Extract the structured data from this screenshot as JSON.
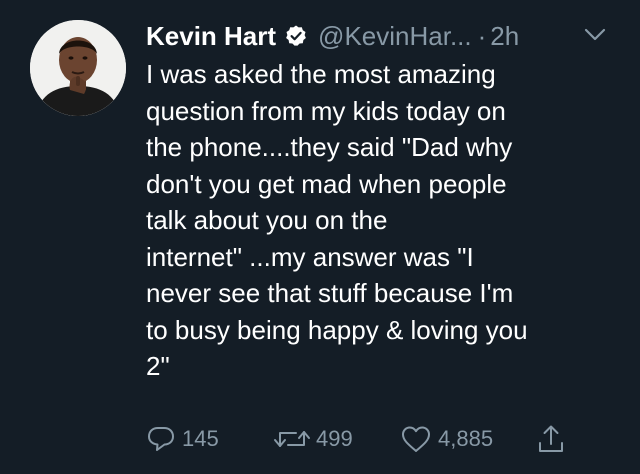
{
  "tweet": {
    "author_name": "Kevin Hart",
    "handle": "@KevinHar...",
    "separator": "·",
    "time": "2h",
    "text_lines": [
      "I was asked the most amazing",
      "question from my kids today on",
      "the phone....they said \"Dad why",
      "don't you get mad when people",
      "talk about you on the",
      "internet\" ...my answer was \"I",
      "never see that stuff because I'm",
      "to busy being happy & loving you",
      "2\""
    ],
    "replies": "145",
    "retweets": "499",
    "likes": "4,885"
  },
  "icons": {
    "verified": "verified-badge-icon",
    "caret": "chevron-down-icon",
    "reply": "reply-icon",
    "retweet": "retweet-icon",
    "like": "heart-icon",
    "share": "share-icon"
  },
  "colors": {
    "background": "#141d26",
    "text_primary": "#ffffff",
    "text_secondary": "#8899a6",
    "verified_badge": "#ffffff"
  }
}
